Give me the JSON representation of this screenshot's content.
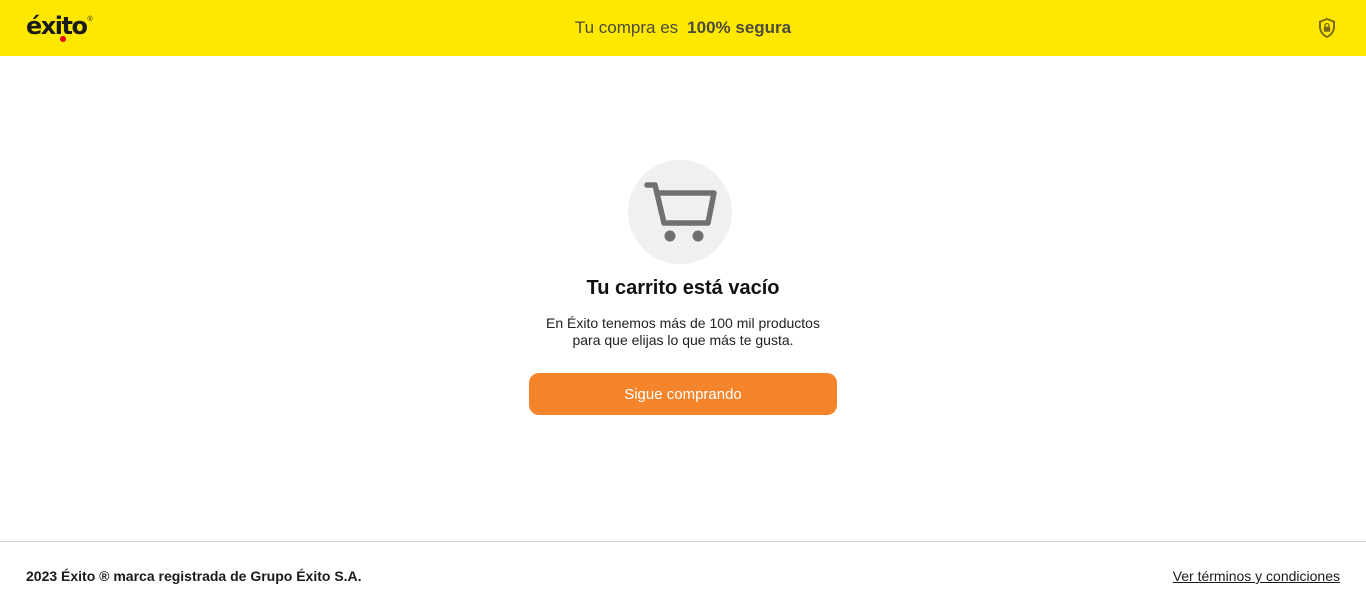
{
  "header": {
    "logo_text": "éxito",
    "logo_reg": "®",
    "secure_prefix": "Tu compra es",
    "secure_highlight": "100% segura",
    "icon": "shield-lock-icon",
    "background": "#ffe800"
  },
  "empty_cart": {
    "icon": "cart-icon",
    "title": "Tu carrito está vacío",
    "description_line1": "En Éxito tenemos más de 100 mil productos",
    "description_line2": "para que elijas lo que más te gusta.",
    "button_label": "Sigue comprando",
    "button_color": "#f5842a"
  },
  "footer": {
    "copyright": "2023 Éxito ® marca registrada de Grupo Éxito S.A.",
    "terms_link": "Ver términos y condiciones"
  }
}
